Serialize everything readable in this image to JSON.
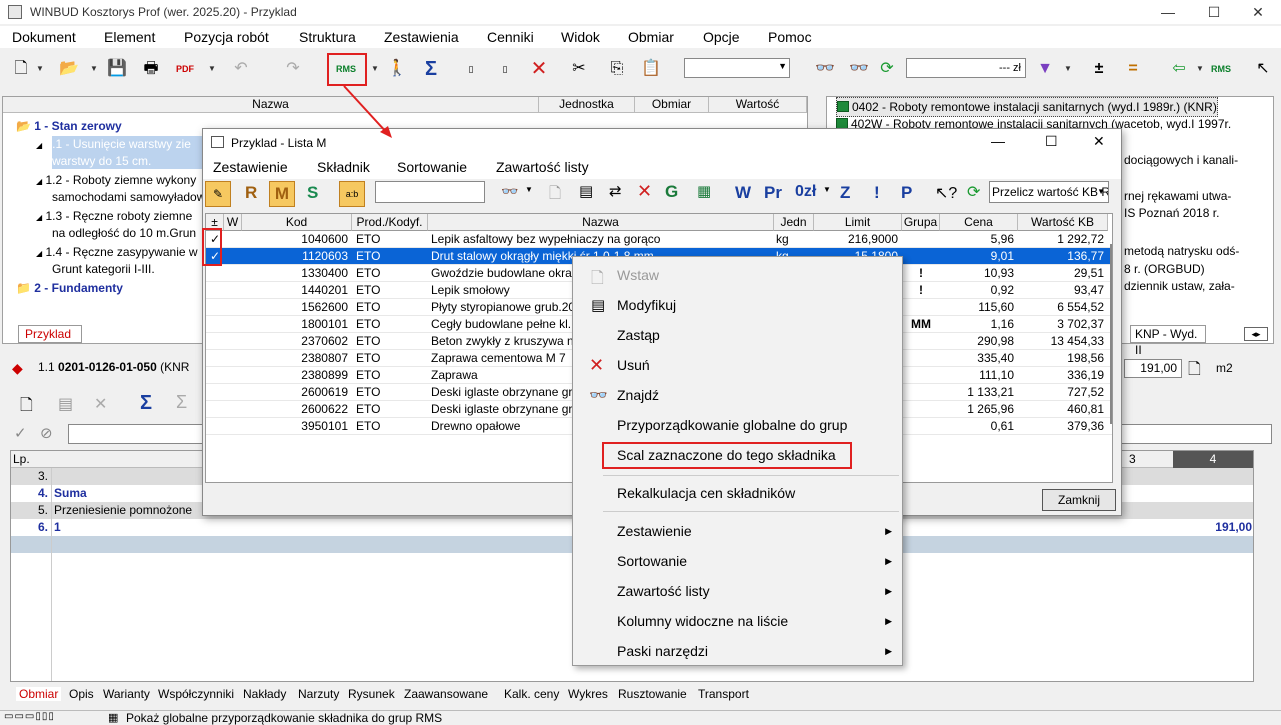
{
  "window": {
    "title": "WINBUD Kosztorys Prof (wer. 2025.20) - Przyklad"
  },
  "menu": [
    "Dokument",
    "Element",
    "Pozycja robót",
    "Struktura",
    "Zestawienia",
    "Cenniki",
    "Widok",
    "Obmiar",
    "Opcje",
    "Pomoc"
  ],
  "toolbar": {
    "amount_suffix": "--- zł",
    "rms": "RMS"
  },
  "tree": {
    "headers": [
      "Nazwa",
      "Jednostka",
      "Obmiar",
      "Wartość"
    ],
    "items": [
      "1 - Stan zerowy",
      "1.1 - Usunięcie warstwy zie",
      "warstwy do 15 cm.",
      "1.2 - Roboty ziemne wykony",
      "samochodami samowyładow",
      "1.3 - Ręczne roboty ziemne",
      "na odległość do 10 m.Grun",
      "1.4 - Ręczne zasypywanie w",
      "Grunt kategorii I-III.",
      "2 - Fundamenty"
    ]
  },
  "catalogs": {
    "items": [
      "0402 - Roboty remontowe instalacji sanitarnych (wyd.I 1989r.) (KNR)",
      "402W - Roboty remontowe instalacji sanitarnych (wacetob, wyd.I 1997r.",
      "dociągowych i kanali-",
      "rnej rękawami utwa-",
      "IS Poznań 2018 r.",
      "metodą natrysku odś-",
      "8 r. (ORGBUD)",
      "dziennik ustaw, zała-"
    ],
    "tab_label": "KNP - Wyd. II"
  },
  "doc_tab": "Przyklad",
  "position": {
    "number": "1.1",
    "code": "0201-0126-01-050",
    "suffix": "(KNR",
    "qty": "191,00",
    "unit": "m2"
  },
  "measure": {
    "header_lp": "Lp.",
    "col3": "3",
    "col4": "4",
    "rows": [
      {
        "lp": "3.",
        "text": "",
        "val": ""
      },
      {
        "lp": "4.",
        "text": "Suma",
        "val": ""
      },
      {
        "lp": "5.",
        "text": "Przeniesienie pomnożone",
        "val": ""
      },
      {
        "lp": "6.",
        "text": "1",
        "val": "191,00"
      }
    ]
  },
  "dialog": {
    "title": "Przyklad - Lista M",
    "menu": [
      "Zestawienie",
      "Składnik",
      "Sortowanie",
      "Zawartość listy"
    ],
    "tool_letters": {
      "r": "R",
      "m": "M",
      "s": "S",
      "w": "W",
      "pr": "Pr",
      "zl": "0zł",
      "z": "Z",
      "ex": "!",
      "p": "P"
    },
    "recalc_combo": "Przelicz wartość KB R",
    "columns": [
      "±",
      "W",
      "Kod",
      "Prod./Kodyf.",
      "Nazwa",
      "Jedn",
      "Limit",
      "Grupa",
      "Cena",
      "Wartość KB"
    ],
    "rows": [
      {
        "check": "✓",
        "kod": "1040600",
        "prod": "ETO",
        "nazwa": "Lepik asfaltowy bez wypełniaczy na gorąco",
        "jedn": "kg",
        "limit": "216,9000",
        "grupa": "",
        "cena": "5,96",
        "wartosc": "1 292,72"
      },
      {
        "check": "✓",
        "kod": "1120603",
        "prod": "ETO",
        "nazwa": "Drut stalowy okrągły miękki śr 1,0-1,8 mm",
        "jedn": "kg",
        "limit": "15,1800",
        "grupa": "",
        "cena": "9,01",
        "wartosc": "136,77"
      },
      {
        "check": "",
        "kod": "1330400",
        "prod": "ETO",
        "nazwa": "Gwoździe budowlane okra",
        "jedn": "",
        "limit": "",
        "grupa": "!",
        "cena": "10,93",
        "wartosc": "29,51"
      },
      {
        "check": "",
        "kod": "1440201",
        "prod": "ETO",
        "nazwa": "Lepik smołowy",
        "jedn": "",
        "limit": "",
        "grupa": "!",
        "cena": "0,92",
        "wartosc": "93,47"
      },
      {
        "check": "",
        "kod": "1562600",
        "prod": "ETO",
        "nazwa": "Płyty styropianowe grub.20",
        "jedn": "",
        "limit": "",
        "grupa": "",
        "cena": "115,60",
        "wartosc": "6 554,52"
      },
      {
        "check": "",
        "kod": "1800101",
        "prod": "ETO",
        "nazwa": "Cegły budowlane pełne kl.",
        "jedn": "",
        "limit": "",
        "grupa": "MM",
        "cena": "1,16",
        "wartosc": "3 702,37"
      },
      {
        "check": "",
        "kod": "2370602",
        "prod": "ETO",
        "nazwa": "Beton zwykły z kruszywa na",
        "jedn": "",
        "limit": "",
        "grupa": "",
        "cena": "290,98",
        "wartosc": "13 454,33"
      },
      {
        "check": "",
        "kod": "2380807",
        "prod": "ETO",
        "nazwa": "Zaprawa cementowa M 7",
        "jedn": "",
        "limit": "",
        "grupa": "",
        "cena": "335,40",
        "wartosc": "198,56"
      },
      {
        "check": "",
        "kod": "2380899",
        "prod": "ETO",
        "nazwa": "Zaprawa",
        "jedn": "",
        "limit": "",
        "grupa": "",
        "cena": "111,10",
        "wartosc": "336,19"
      },
      {
        "check": "",
        "kod": "2600619",
        "prod": "ETO",
        "nazwa": "Deski iglaste obrzynane gr",
        "jedn": "",
        "limit": "",
        "grupa": "",
        "cena": "1 133,21",
        "wartosc": "727,52"
      },
      {
        "check": "",
        "kod": "2600622",
        "prod": "ETO",
        "nazwa": "Deski iglaste obrzynane gr",
        "jedn": "",
        "limit": "",
        "grupa": "",
        "cena": "1 265,96",
        "wartosc": "460,81"
      },
      {
        "check": "",
        "kod": "3950101",
        "prod": "ETO",
        "nazwa": "Drewno opałowe",
        "jedn": "",
        "limit": "",
        "grupa": "",
        "cena": "0,61",
        "wartosc": "379,36"
      }
    ],
    "close_button": "Zamknij"
  },
  "context_menu": {
    "items": [
      {
        "label": "Wstaw",
        "disabled": true,
        "submenu": false
      },
      {
        "label": "Modyfikuj",
        "disabled": false,
        "submenu": false
      },
      {
        "label": "Zastąp",
        "disabled": false,
        "submenu": false
      },
      {
        "label": "Usuń",
        "disabled": false,
        "submenu": false
      },
      {
        "label": "Znajdź",
        "disabled": false,
        "submenu": false
      },
      {
        "label": "Przyporządkowanie globalne do grup",
        "disabled": false,
        "submenu": false
      },
      {
        "label": "Scal zaznaczone do tego składnika",
        "disabled": false,
        "submenu": false
      },
      {
        "label": "Rekalkulacja cen składników",
        "disabled": false,
        "submenu": false
      },
      {
        "label": "Zestawienie",
        "disabled": false,
        "submenu": true
      },
      {
        "label": "Sortowanie",
        "disabled": false,
        "submenu": true
      },
      {
        "label": "Zawartość listy",
        "disabled": false,
        "submenu": true
      },
      {
        "label": "Kolumny widoczne na liście",
        "disabled": false,
        "submenu": true
      },
      {
        "label": "Paski narzędzi",
        "disabled": false,
        "submenu": true
      }
    ]
  },
  "bottom_tabs": [
    "Obmiar",
    "Opis",
    "Warianty",
    "Współczynniki",
    "Nakłady",
    "Narzuty",
    "Rysunek",
    "Zaawansowane",
    "Kalk. ceny",
    "Wykres",
    "Rusztowanie",
    "Transport"
  ],
  "status": {
    "text": "Pokaż globalne przyporządkowanie składnika do grup RMS"
  },
  "colors": {
    "selection": "#0a64d6",
    "highlight_box": "#e02020",
    "tree_blue": "#1f2f9f"
  }
}
